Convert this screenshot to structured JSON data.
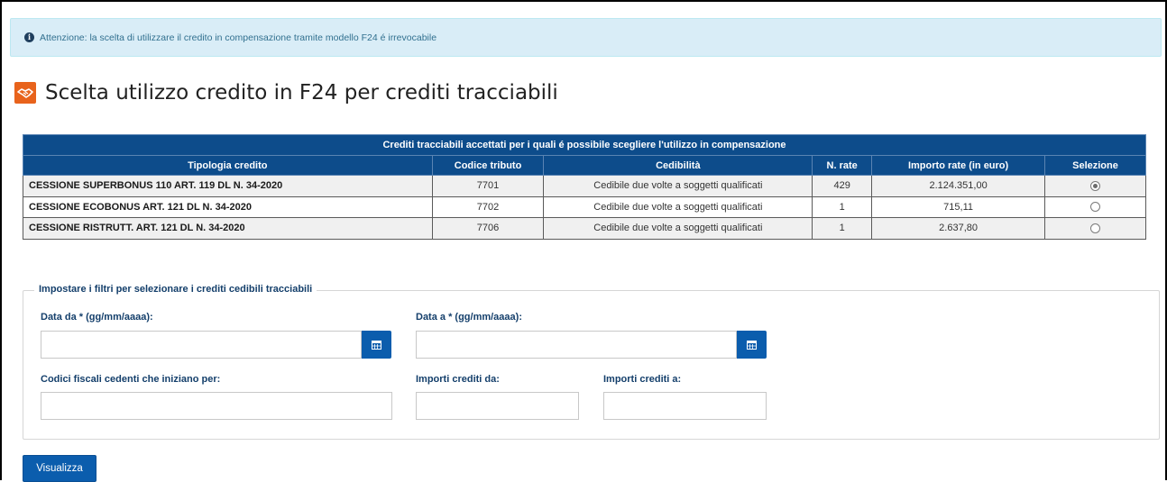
{
  "alert": {
    "icon": "info-icon",
    "text": "Attenzione: la scelta di utilizzare il credito in compensazione tramite modello F24 é irrevocabile"
  },
  "page": {
    "title": "Scelta utilizzo credito in F24 per crediti tracciabili",
    "title_icon": "handshake-icon",
    "accent_color": "#e8631c"
  },
  "table": {
    "caption": "Crediti tracciabili accettati per i quali é possibile scegliere l'utilizzo in compensazione",
    "header_color": "#0d4c8b",
    "columns": [
      "Tipologia credito",
      "Codice tributo",
      "Cedibilità",
      "N. rate",
      "Importo rate (in euro)",
      "Selezione"
    ],
    "rows": [
      {
        "tipologia": "CESSIONE SUPERBONUS 110 ART. 119 DL N. 34-2020",
        "codice": "7701",
        "cedibilita": "Cedibile due volte a soggetti qualificati",
        "n_rate": "429",
        "importo": "2.124.351,00",
        "selected": true
      },
      {
        "tipologia": "CESSIONE ECOBONUS ART. 121 DL N. 34-2020",
        "codice": "7702",
        "cedibilita": "Cedibile due volte a soggetti qualificati",
        "n_rate": "1",
        "importo": "715,11",
        "selected": false
      },
      {
        "tipologia": "CESSIONE RISTRUTT. ART. 121 DL N. 34-2020",
        "codice": "7706",
        "cedibilita": "Cedibile due volte a soggetti qualificati",
        "n_rate": "1",
        "importo": "2.637,80",
        "selected": false
      }
    ]
  },
  "filters": {
    "legend": "Impostare i filtri per selezionare i crediti cedibili tracciabili",
    "data_da_label": "Data da * (gg/mm/aaaa):",
    "data_da_value": "",
    "data_a_label": "Data a * (gg/mm/aaaa):",
    "data_a_value": "",
    "codici_label": "Codici fiscali cedenti che iniziano per:",
    "codici_value": "",
    "importi_da_label": "Importi crediti da:",
    "importi_da_value": "",
    "importi_a_label": "Importi crediti a:",
    "importi_a_value": "",
    "calendar_icon": "calendar-icon"
  },
  "actions": {
    "visualizza_label": "Visualizza",
    "button_color": "#0b5dad"
  }
}
